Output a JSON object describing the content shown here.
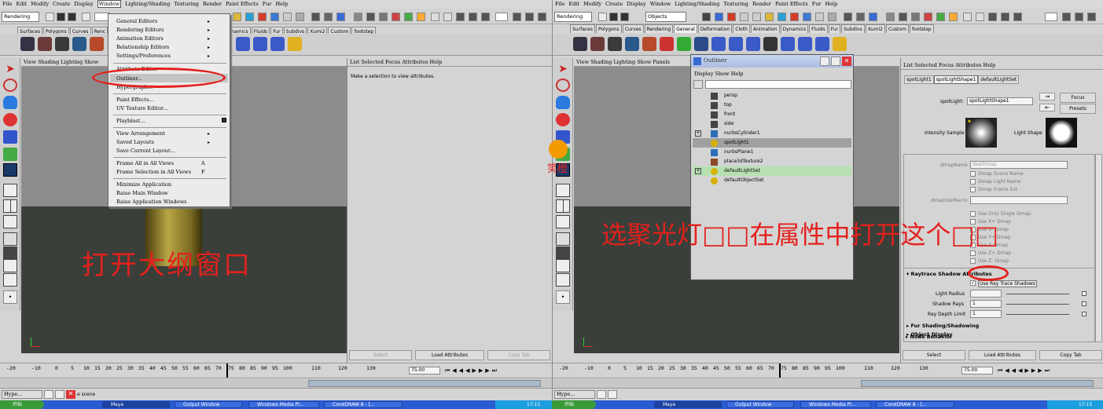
{
  "left": {
    "menubar": [
      "File",
      "Edit",
      "Modify",
      "Create",
      "Display",
      "Window",
      "Lighting/Shading",
      "Texturing",
      "Render",
      "Paint Effects",
      "Fur",
      "Help"
    ],
    "mode_dropdown": "Rendering",
    "shelf_tabs_partial": [
      "Dynamics",
      "Fluids",
      "Fur",
      "Subdivs",
      "Xumi2",
      "Custom",
      "footstep"
    ],
    "shelf_tab_surfaces": "Surfaces",
    "shelf_tab_polygons": "Polygons",
    "shelf_tab_curves": "Curves",
    "shelf_tab_rend": "Renc",
    "viewport_menu": [
      "View",
      "Shading",
      "Lighting",
      "Show"
    ],
    "window_menu": {
      "group1": [
        "General Editors",
        "Rendering Editors",
        "Animation Editors",
        "Relationship Editors",
        "Settings/Preferences"
      ],
      "group2": [
        "Attribute Editor",
        "Outliner...",
        "Hypergraph..."
      ],
      "group3": [
        "Paint Effects...",
        "UV Texture Editor..."
      ],
      "group4": [
        "Playblast..."
      ],
      "group5": [
        "View Arrangement",
        "Saved Layouts",
        "Save Current Layout..."
      ],
      "group6": [
        [
          "Frame All in All Views",
          "A"
        ],
        [
          "Frame Selection in All Views",
          "F"
        ]
      ],
      "group7": [
        "Minimize Application",
        "Raise Main Window",
        "Raise Application Windows"
      ]
    },
    "attr_menu": [
      "List",
      "Selected",
      "Focus",
      "Attributes",
      "Help"
    ],
    "attr_message": "Make a selection to view attributes.",
    "attr_buttons": {
      "select": "Select",
      "load": "Load Attributes",
      "copy": "Copy Tab"
    },
    "caption": "打开大纲窗口",
    "timeline_ticks": [
      "-20",
      "-10",
      "0",
      "5",
      "10",
      "15",
      "20",
      "25",
      "30",
      "35",
      "40",
      "45",
      "50",
      "55",
      "60",
      "65",
      "70",
      "75",
      "80",
      "85",
      "90",
      "95",
      "100",
      "110",
      "120",
      "130"
    ],
    "range_end": "75.00",
    "cmd_text": "e scene",
    "hype_label": "Hype..."
  },
  "right": {
    "menubar": [
      "File",
      "Edit",
      "Modify",
      "Create",
      "Display",
      "Window",
      "Lighting/Shading",
      "Texturing",
      "Render",
      "Paint Effects",
      "Fur",
      "Help"
    ],
    "mode_dropdown": "Rendering",
    "objects_dropdown": "Objects",
    "shelf_tabs": [
      "Surfaces",
      "Polygons",
      "Curves",
      "Rendering",
      "General",
      "Deformation",
      "Cloth",
      "Animation",
      "Dynamics",
      "Fluids",
      "Fur",
      "Subdivs",
      "Xumi2",
      "Custom",
      "footstep"
    ],
    "viewport_menu": [
      "View",
      "Shading",
      "Lighting",
      "Show",
      "Panels"
    ],
    "outliner": {
      "title": "Outliner",
      "menu": [
        "Display",
        "Show",
        "Help"
      ],
      "items": [
        {
          "label": "persp",
          "color": "#444"
        },
        {
          "label": "top",
          "color": "#444"
        },
        {
          "label": "front",
          "color": "#444"
        },
        {
          "label": "side",
          "color": "#444"
        },
        {
          "label": "nurbsCylinder1",
          "color": "#2b6fb8"
        },
        {
          "label": "spotLight1",
          "color": "#d8b000"
        },
        {
          "label": "nurbsPlane1",
          "color": "#2b6fb8"
        },
        {
          "label": "place3dTexture2",
          "color": "#8a4a2a"
        },
        {
          "label": "defaultLightSet",
          "color": "#d8b000"
        },
        {
          "label": "defaultObjectSet",
          "color": "#d8b000"
        }
      ]
    },
    "attr_menu": [
      "List",
      "Selected",
      "Focus",
      "Attributes",
      "Help"
    ],
    "tabs": [
      "spotLight1",
      "spotLightShape1",
      "defaultLightSet"
    ],
    "spotlight_label": "spotLight:",
    "spotlight_value": "spotLightShape1",
    "focus_btn": "Focus",
    "presets_btn": "Presets",
    "intensity_sample": "Intensity Sample",
    "light_shape": "Light Shape",
    "dmap_name_label": "dmapName",
    "dmap_name_value": "depthmap",
    "dmap_checks": [
      "Dmap Scene Name",
      "Dmap Light Name",
      "Dmap Frame Ext"
    ],
    "dmap_use_macro": "dmapUseMacro",
    "dmap_checks2": [
      "Use Only Single Dmap",
      "Use X+ Dmap",
      "Use X- Dmap",
      "Use Y+ Dmap",
      "Use Y- Dmap",
      "Use Z+ Dmap",
      "Use Z- Dmap"
    ],
    "raytrace_header": "Raytrace Shadow Attributes",
    "use_ray_trace": "Use Ray Trace Shadows",
    "light_radius_label": "Light Radius",
    "light_radius_value": "",
    "shadow_rays_label": "Shadow Rays",
    "shadow_rays_value": "1",
    "ray_depth_label": "Ray Depth Limit",
    "ray_depth_value": "1",
    "sections": [
      "Fur Shading/Shadowing",
      "Object Display",
      "Node Behavior"
    ],
    "attr_buttons": {
      "select": "Select",
      "load": "Load Attributes",
      "copy": "Copy Tab"
    },
    "caption": "选聚光灯□□在属性中打开这个□□",
    "timeline_ticks": [
      "-20",
      "-10",
      "0",
      "5",
      "10",
      "15",
      "20",
      "25",
      "30",
      "35",
      "40",
      "45",
      "50",
      "55",
      "60",
      "65",
      "70",
      "75",
      "80",
      "85",
      "90",
      "95",
      "100",
      "110",
      "120",
      "130"
    ],
    "range_end": "75.00",
    "hype_label": "Hype..."
  },
  "taskbar": {
    "start": "开始",
    "tasks": [
      "Maya",
      "Output Window",
      "Windows Media Pl...",
      "CorelDRAW 8 - [..."
    ],
    "clock": "17:15"
  },
  "watermark": "笑橙",
  "colors": {
    "caption": "#e4211d",
    "highlight_row": "#c4c4c4",
    "selected_set": "#b7e0b2",
    "viewport_floor": "#3a3f3a",
    "viewport_sky": "#8c8c8c"
  }
}
